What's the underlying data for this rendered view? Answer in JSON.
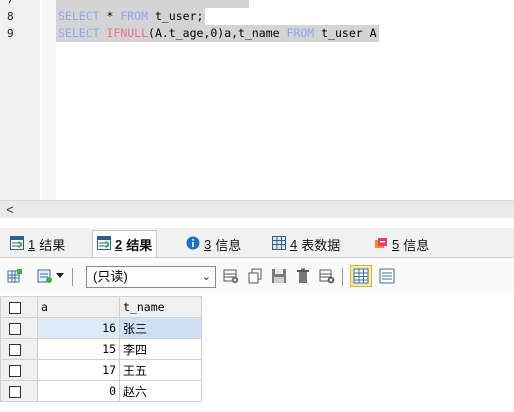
{
  "editor": {
    "lines": [
      {
        "num": "7",
        "tokens": []
      },
      {
        "num": "8",
        "tokens": [
          {
            "t": "SELECT",
            "c": "kw"
          },
          {
            "t": " * ",
            "c": "tx"
          },
          {
            "t": "FROM",
            "c": "kw"
          },
          {
            "t": " t_user;",
            "c": "tx"
          }
        ]
      },
      {
        "num": "9",
        "tokens": [
          {
            "t": "SELECT",
            "c": "kw"
          },
          {
            "t": " ",
            "c": "tx"
          },
          {
            "t": "IFNULL",
            "c": "fn"
          },
          {
            "t": "(A.t_age,0)a,t_name ",
            "c": "tx"
          },
          {
            "t": "FROM",
            "c": "kw"
          },
          {
            "t": " t_user A",
            "c": "tx"
          }
        ]
      }
    ]
  },
  "scroll_left_glyph": "<",
  "tabs": [
    {
      "num": "1",
      "label": "结果",
      "icon": "table-result-icon",
      "active": false
    },
    {
      "num": "2",
      "label": "结果",
      "icon": "table-result-icon",
      "active": true
    },
    {
      "num": "3",
      "label": "信息",
      "icon": "info-icon",
      "active": false
    },
    {
      "num": "4",
      "label": "表数据",
      "icon": "table-data-icon",
      "active": false
    },
    {
      "num": "5",
      "label": "信息",
      "icon": "profile-info-icon",
      "active": false
    }
  ],
  "toolbar": {
    "mode_value": "(只读)",
    "arrow_glyph": "⌄"
  },
  "grid": {
    "columns": [
      "a",
      "t_name"
    ],
    "rows": [
      {
        "a": "16",
        "t_name": "张三",
        "selected": true
      },
      {
        "a": "15",
        "t_name": "李四",
        "selected": false
      },
      {
        "a": "17",
        "t_name": "王五",
        "selected": false
      },
      {
        "a": "0",
        "t_name": "赵六",
        "selected": false
      }
    ]
  },
  "colors": {
    "keyword": "#8ea6f2",
    "function": "#e8718c",
    "selection_bg": "#d4d4d4",
    "selected_row": "#ddeaf8"
  }
}
